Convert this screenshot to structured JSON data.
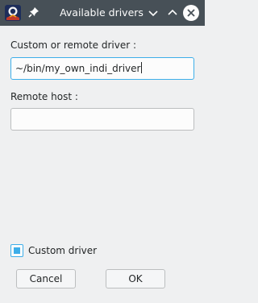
{
  "window": {
    "title": "Available drivers",
    "app_icon": "kstars-app-icon",
    "pin_icon": "pin-icon",
    "minimize_icon": "chevron-down-icon",
    "maximize_icon": "chevron-up-icon",
    "close_icon": "close-icon"
  },
  "form": {
    "driver_label": "Custom or remote driver :",
    "driver_value": "~/bin/my_own_indi_driver",
    "host_label": "Remote host :",
    "host_value": ""
  },
  "custom_driver": {
    "label": "Custom driver",
    "checked": true
  },
  "buttons": {
    "cancel": "Cancel",
    "ok": "OK"
  },
  "colors": {
    "titlebar": "#475057",
    "accent": "#3daee9",
    "background": "#eff0f1"
  }
}
